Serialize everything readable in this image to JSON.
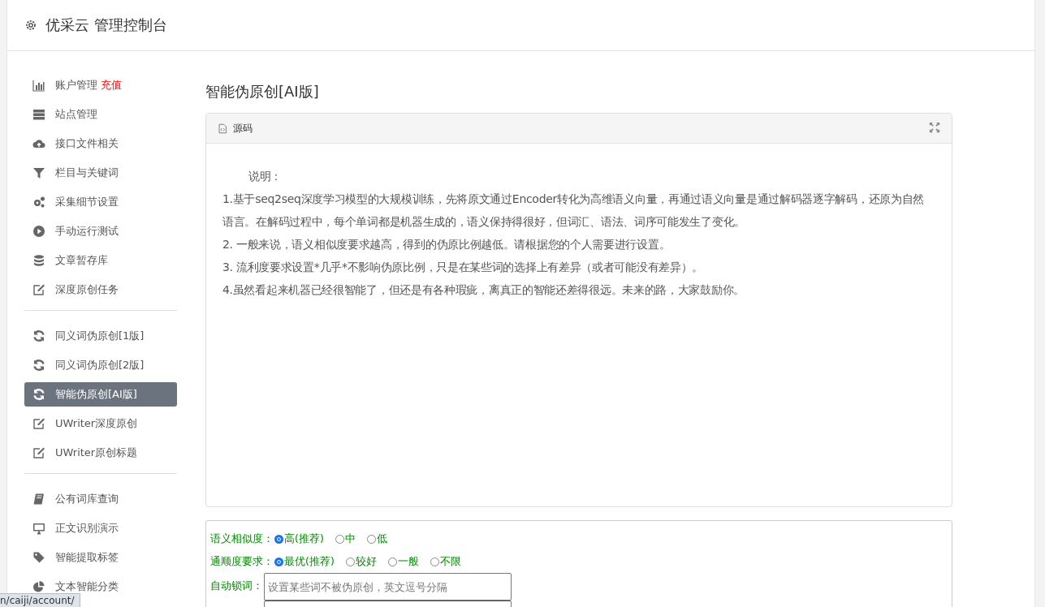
{
  "header": {
    "title": "优采云 管理控制台"
  },
  "sidebar": {
    "groups": [
      [
        {
          "kind": "chart",
          "label": "账户管理",
          "badge": "充值",
          "selected": false
        },
        {
          "kind": "server",
          "label": "站点管理",
          "selected": false
        },
        {
          "kind": "cloud",
          "label": "接口文件相关",
          "selected": false
        },
        {
          "kind": "filter",
          "label": "栏目与关键词",
          "selected": false
        },
        {
          "kind": "gears",
          "label": "采集细节设置",
          "selected": false
        },
        {
          "kind": "play",
          "label": "手动运行测试",
          "selected": false
        },
        {
          "kind": "database",
          "label": "文章暂存库",
          "selected": false
        },
        {
          "kind": "edit",
          "label": "深度原创任务",
          "selected": false
        }
      ],
      [
        {
          "kind": "refresh",
          "label": "同义词伪原创[1版]",
          "selected": false
        },
        {
          "kind": "refresh",
          "label": "同义词伪原创[2版]",
          "selected": false
        },
        {
          "kind": "refresh",
          "label": "智能伪原创[AI版]",
          "selected": true
        },
        {
          "kind": "edit",
          "label": "UWriter深度原创",
          "selected": false
        },
        {
          "kind": "edit",
          "label": "UWriter原创标题",
          "selected": false
        }
      ],
      [
        {
          "kind": "book",
          "label": "公有词库查询",
          "selected": false
        },
        {
          "kind": "monitor",
          "label": "正文识别演示",
          "selected": false
        },
        {
          "kind": "tag",
          "label": "智能提取标签",
          "selected": false
        },
        {
          "kind": "pie",
          "label": "文本智能分类",
          "selected": false
        }
      ]
    ]
  },
  "page": {
    "title": "智能伪原创[AI版]"
  },
  "editor": {
    "toolbar_label": "源码",
    "heading": "说明：",
    "lines": [
      "1.基于seq2seq深度学习模型的大规模训练，先将原文通过Encoder转化为高维语义向量，再通过语义向量是通过解码器逐字解码，还原为自然语言。在解码过程中，每个单词都是机器生成的，语义保持得很好，但词汇、语法、词序可能发生了变化。",
      "2. 一般来说，语义相似度要求越高，得到的伪原比例越低。请根据您的个人需要进行设置。",
      "3. 流利度要求设置*几乎*不影响伪原比例，只是在某些词的选择上有差异（或者可能没有差异）。",
      "4.虽然看起来机器已经很智能了，但还是有各种瑕疵，离真正的智能还差得很远。未来的路，大家鼓励你。"
    ]
  },
  "form": {
    "radio_groups": [
      {
        "label": "语义相似度：",
        "options": [
          {
            "label": "高(推荐)",
            "selected": true
          },
          {
            "label": "中",
            "selected": false
          },
          {
            "label": "低",
            "selected": false
          }
        ]
      },
      {
        "label": "通顺度要求：",
        "options": [
          {
            "label": "最优(推荐)",
            "selected": true
          },
          {
            "label": "较好",
            "selected": false
          },
          {
            "label": "一般",
            "selected": false
          },
          {
            "label": "不限",
            "selected": false
          }
        ]
      }
    ],
    "lock_words": {
      "label": "自动锁词：",
      "placeholder": "设置某些词不被伪原创，英文逗号分隔"
    }
  },
  "status_bar": {
    "url": "n/caiji/account/"
  }
}
